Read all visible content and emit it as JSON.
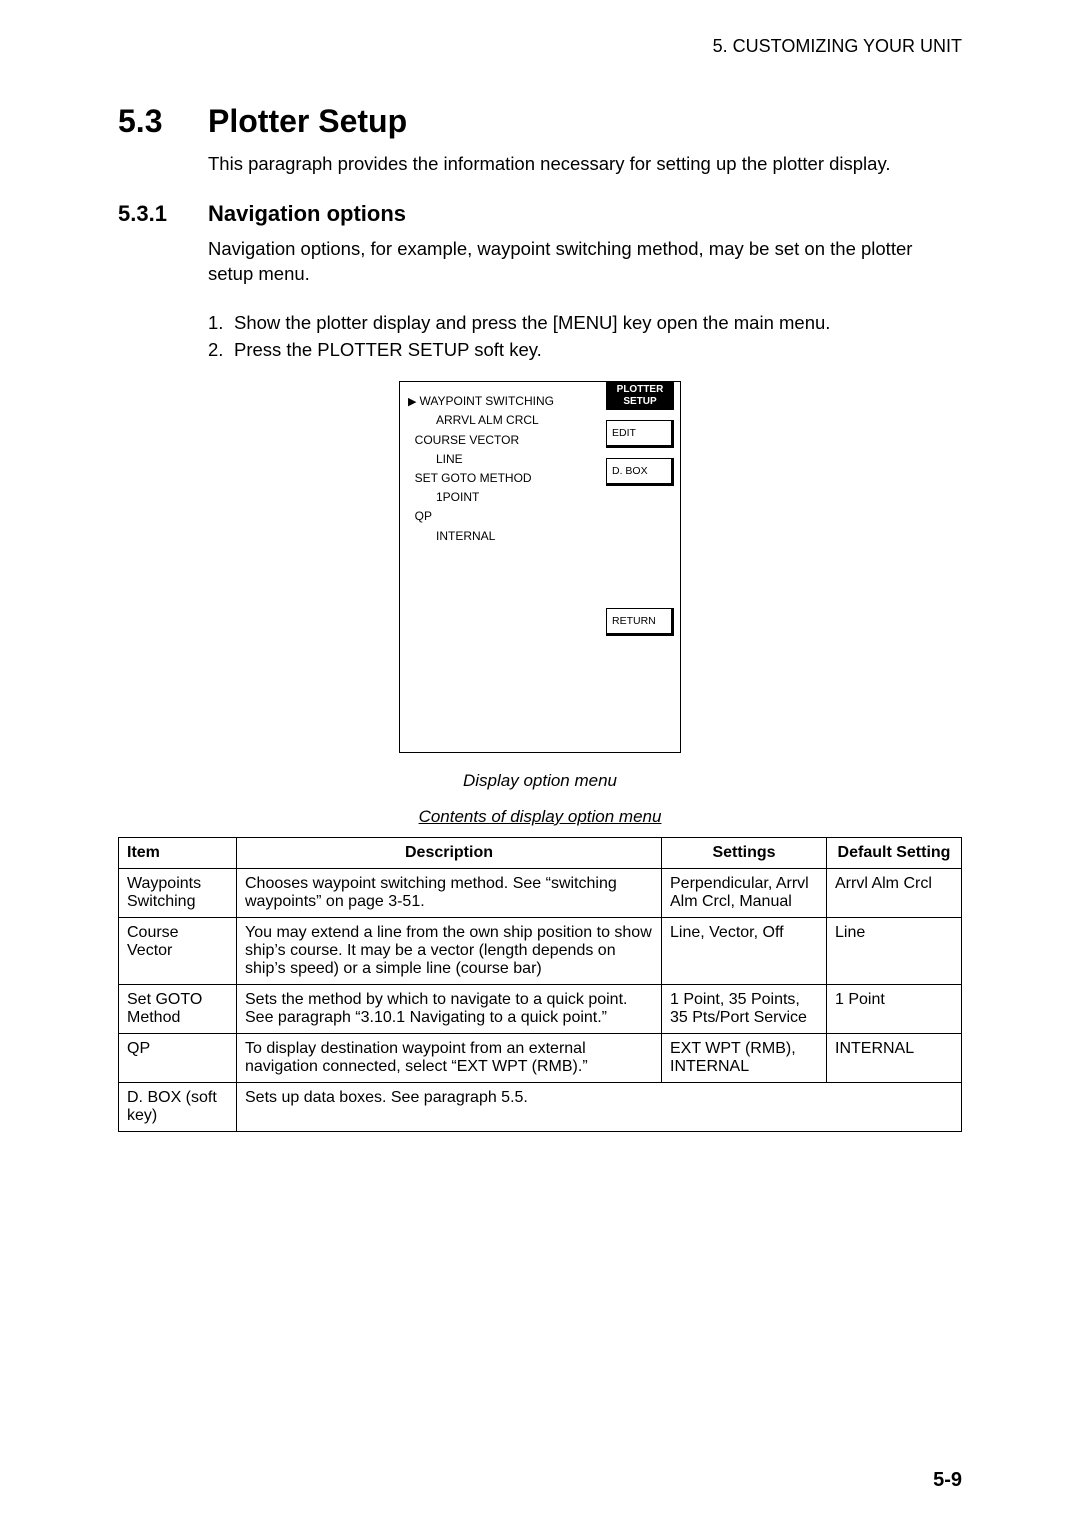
{
  "header": {
    "running": "5. CUSTOMIZING YOUR UNIT"
  },
  "section": {
    "num": "5.3",
    "title": "Plotter Setup",
    "intro": "This paragraph provides the information necessary for setting up the plotter display."
  },
  "subsection": {
    "num": "5.3.1",
    "title": "Navigation options",
    "intro": "Navigation options, for example, waypoint switching method, may be set on the plotter setup menu.",
    "steps": [
      "Show the plotter display and press the [MENU] key open the main menu.",
      "Press the PLOTTER SETUP soft key."
    ]
  },
  "figure": {
    "menu": {
      "items": [
        {
          "label": "WAYPOINT SWITCHING",
          "value": "ARRVL ALM CRCL",
          "cursor": true
        },
        {
          "label": "COURSE VECTOR",
          "value": "LINE",
          "cursor": false
        },
        {
          "label": "SET GOTO METHOD",
          "value": "1POINT",
          "cursor": false
        },
        {
          "label": "QP",
          "value": "INTERNAL",
          "cursor": false
        }
      ]
    },
    "softlabel_top": "PLOTTER",
    "softlabel_bot": "SETUP",
    "softkeys": {
      "edit": "EDIT",
      "dbox": "D. BOX",
      "ret": "RETURN"
    },
    "caption": "Display option menu",
    "table_caption": "Contents of display option menu"
  },
  "table": {
    "headers": {
      "item": "Item",
      "desc": "Description",
      "settings": "Settings",
      "def": "Default Setting"
    },
    "rows": [
      {
        "item": "Waypoints Switching",
        "desc": "Chooses waypoint switching method. See “switching waypoints” on page 3-51.",
        "settings": "Perpendicular, Arrvl Alm Crcl, Manual",
        "def": "Arrvl Alm Crcl"
      },
      {
        "item": "Course Vector",
        "desc": "You may extend a line from the own ship position to show ship’s course. It may be a vector (length depends on ship’s speed) or a simple line (course bar)",
        "settings": "Line, Vector, Off",
        "def": "Line"
      },
      {
        "item": "Set GOTO Method",
        "desc": "Sets the method by which to navigate to a quick point. See paragraph “3.10.1 Navigating to a quick point.”",
        "settings": "1 Point, 35 Points, 35 Pts/Port Service",
        "def": "1 Point"
      },
      {
        "item": "QP",
        "desc": "To display destination waypoint from an external navigation connected, select “EXT WPT (RMB).”",
        "settings": "EXT WPT (RMB), INTERNAL",
        "def": "INTERNAL"
      },
      {
        "item": "D. BOX (soft key)",
        "desc": "Sets up data boxes. See paragraph 5.5.",
        "settings": "",
        "def": ""
      }
    ]
  },
  "pagenum": "5-9"
}
